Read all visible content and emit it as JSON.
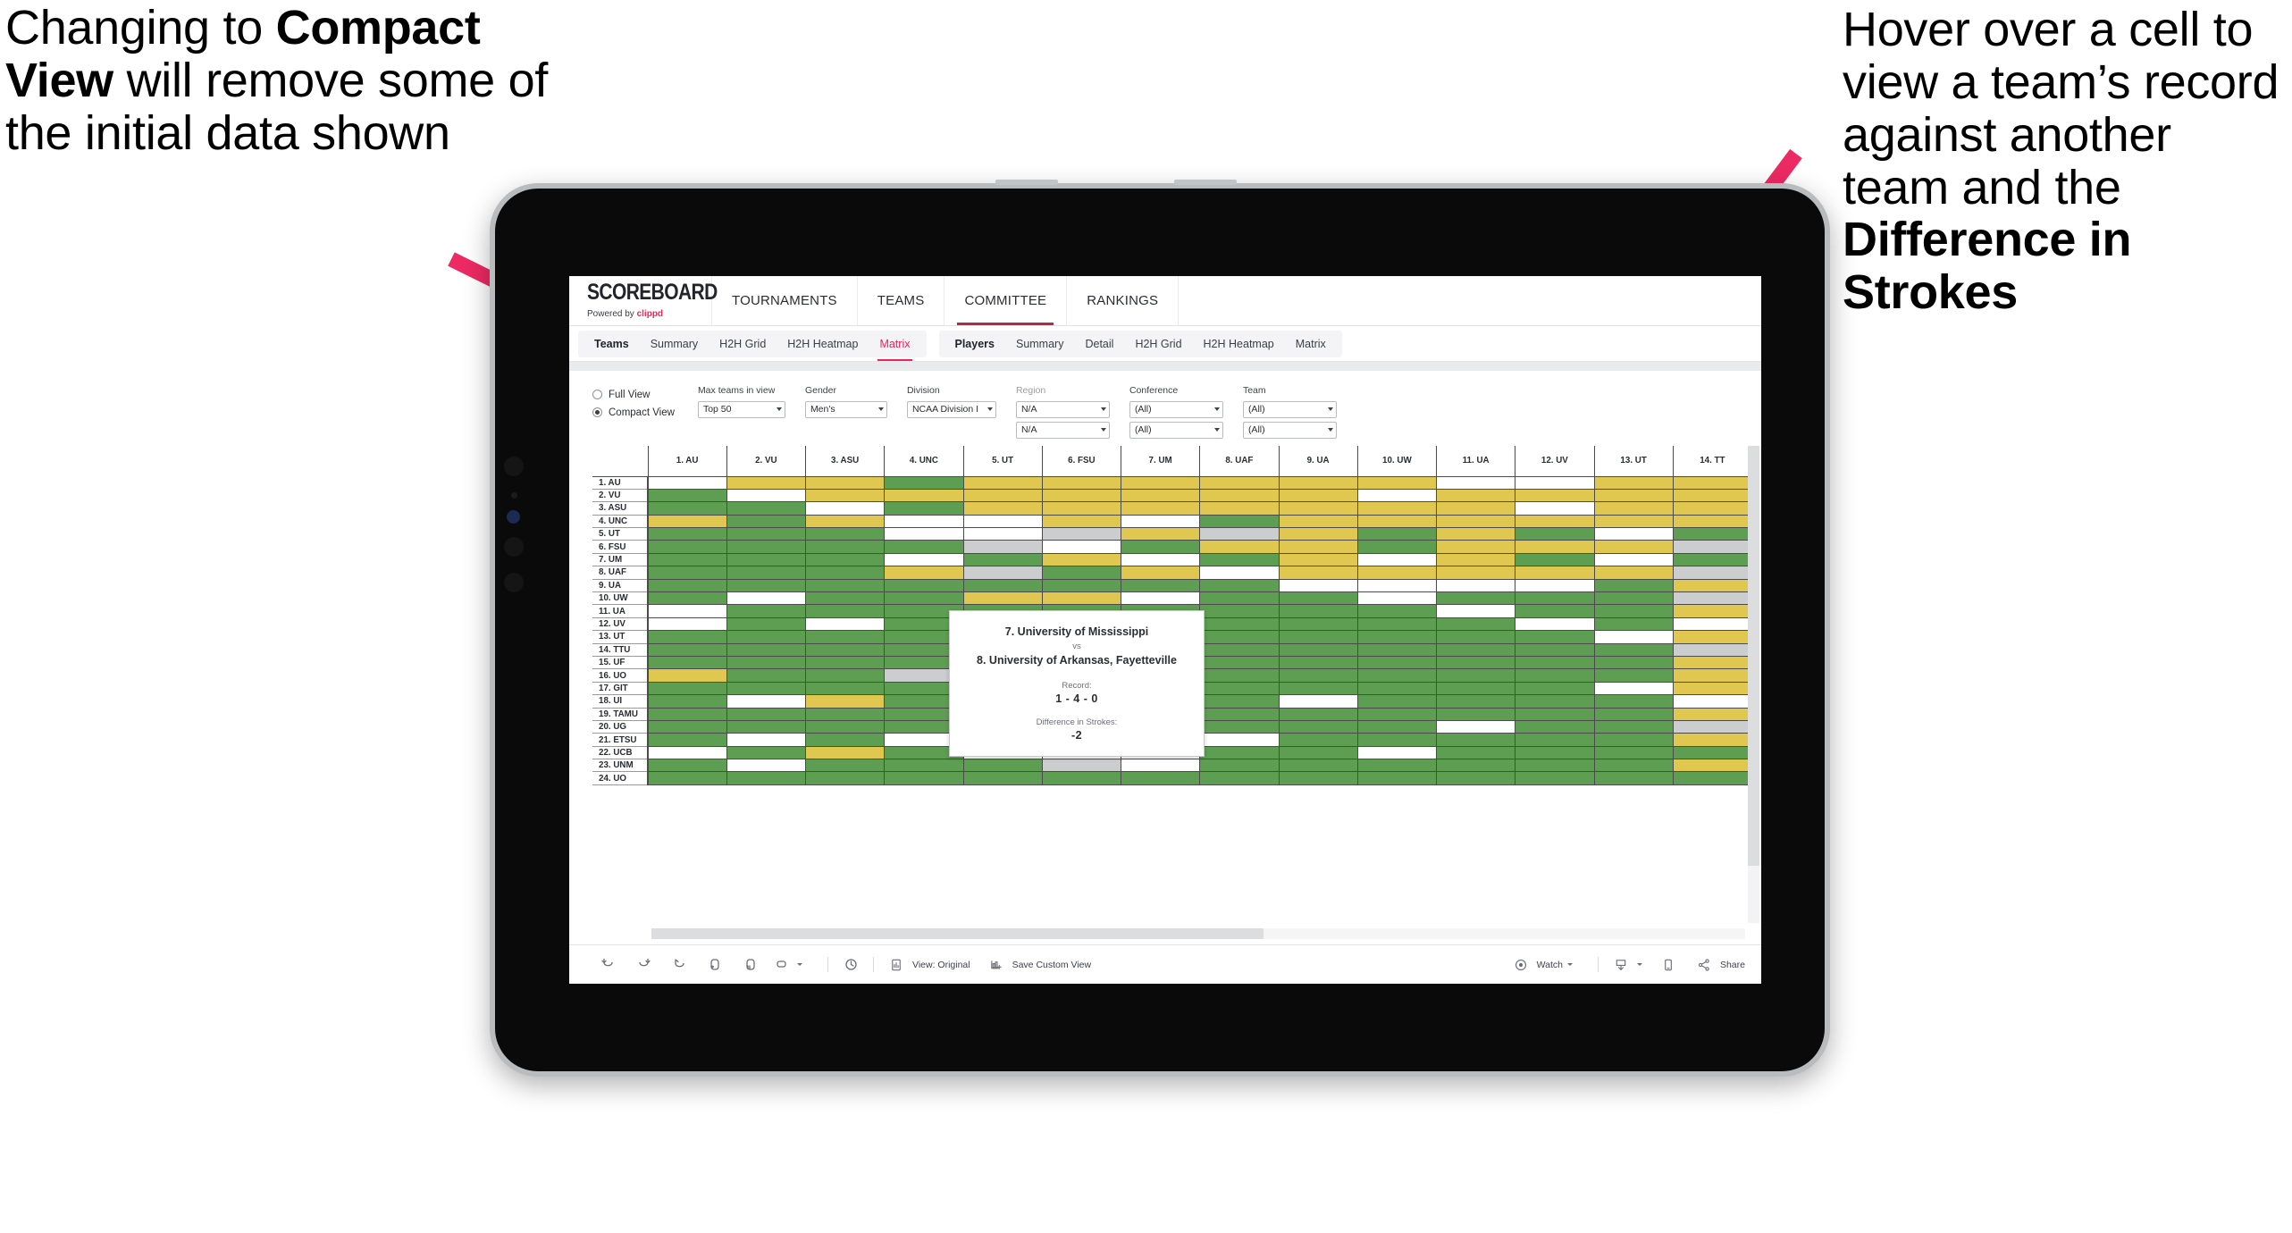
{
  "annotations": {
    "left": {
      "pre": "Changing to ",
      "bold": "Compact View",
      "post": " will remove some of the initial data shown"
    },
    "right": {
      "pre": "Hover over a cell to view a team’s record against another team and the ",
      "bold": "Difference in Strokes",
      "post": ""
    },
    "arrow_color": "#ed2a63"
  },
  "app": {
    "brand": {
      "logo": "SCOREBOARD",
      "powered_prefix": "Powered by ",
      "powered_name": "clippd"
    },
    "topnav": [
      {
        "label": "TOURNAMENTS",
        "active": false
      },
      {
        "label": "TEAMS",
        "active": false
      },
      {
        "label": "COMMITTEE",
        "active": true
      },
      {
        "label": "RANKINGS",
        "active": false
      }
    ],
    "subnav_teams": {
      "head": "Teams",
      "items": [
        "Summary",
        "H2H Grid",
        "H2H Heatmap",
        "Matrix"
      ],
      "active": "Matrix"
    },
    "subnav_players": {
      "head": "Players",
      "items": [
        "Summary",
        "Detail",
        "H2H Grid",
        "H2H Heatmap",
        "Matrix"
      ],
      "active": ""
    }
  },
  "filters": {
    "view_mode": {
      "options": [
        "Full View",
        "Compact View"
      ],
      "selected": "Compact View"
    },
    "fields": [
      {
        "label": "Max teams in view",
        "muted": false,
        "values": [
          "Top 50"
        ]
      },
      {
        "label": "Gender",
        "muted": false,
        "values": [
          "Men's"
        ]
      },
      {
        "label": "Division",
        "muted": false,
        "values": [
          "NCAA Division I"
        ]
      },
      {
        "label": "Region",
        "muted": true,
        "values": [
          "N/A",
          "N/A"
        ]
      },
      {
        "label": "Conference",
        "muted": false,
        "values": [
          "(All)",
          "(All)"
        ]
      },
      {
        "label": "Team",
        "muted": false,
        "values": [
          "(All)",
          "(All)"
        ]
      }
    ]
  },
  "tooltip": {
    "team_a": "7. University of Mississippi",
    "vs": "vs",
    "team_b": "8. University of Arkansas, Fayetteville",
    "record_label": "Record:",
    "record_value": "1 - 4 - 0",
    "diff_label": "Difference in Strokes:",
    "diff_value": "-2"
  },
  "toolbar": {
    "view_original": "View: Original",
    "save_custom_view": "Save Custom View",
    "watch": "Watch",
    "share": "Share"
  },
  "chart_data": {
    "type": "heatmap",
    "title": "Team Head-to-Head Matrix",
    "legend": {
      "win": "#5e9e52",
      "loss": "#e0c850",
      "tie": "#cccdcf",
      "none": "#ffffff"
    },
    "columns": [
      "1. AU",
      "2. VU",
      "3. ASU",
      "4. UNC",
      "5. UT",
      "6. FSU",
      "7. UM",
      "8. UAF",
      "9. UA",
      "10. UW",
      "11. UA",
      "12. UV",
      "13. UT",
      "14. TT"
    ],
    "rows": [
      "1. AU",
      "2. VU",
      "3. ASU",
      "4. UNC",
      "5. UT",
      "6. FSU",
      "7. UM",
      "8. UAF",
      "9. UA",
      "10. UW",
      "11. UA",
      "12. UV",
      "13. UT",
      "14. TTU",
      "15. UF",
      "16. UO",
      "17. GIT",
      "18. UI",
      "19. TAMU",
      "20. UG",
      "21. ETSU",
      "22. UCB",
      "23. UNM",
      "24. UO"
    ],
    "cells": [
      [
        "w",
        "y",
        "y",
        "g",
        "y",
        "y",
        "y",
        "y",
        "y",
        "y",
        "w",
        "w",
        "y",
        "y"
      ],
      [
        "g",
        "w",
        "y",
        "y",
        "y",
        "y",
        "y",
        "y",
        "y",
        "w",
        "y",
        "y",
        "y",
        "y"
      ],
      [
        "g",
        "g",
        "w",
        "g",
        "y",
        "y",
        "y",
        "y",
        "y",
        "y",
        "y",
        "w",
        "y",
        "y"
      ],
      [
        "y",
        "g",
        "y",
        "w",
        "w",
        "y",
        "w",
        "g",
        "y",
        "y",
        "y",
        "y",
        "y",
        "y"
      ],
      [
        "g",
        "g",
        "g",
        "w",
        "w",
        "s",
        "y",
        "s",
        "y",
        "g",
        "y",
        "g",
        "w",
        "g"
      ],
      [
        "g",
        "g",
        "g",
        "g",
        "s",
        "w",
        "g",
        "y",
        "y",
        "g",
        "y",
        "y",
        "y",
        "s"
      ],
      [
        "g",
        "g",
        "g",
        "w",
        "g",
        "y",
        "w",
        "g",
        "y",
        "w",
        "y",
        "g",
        "w",
        "g"
      ],
      [
        "g",
        "g",
        "g",
        "y",
        "s",
        "g",
        "y",
        "w",
        "y",
        "y",
        "y",
        "y",
        "y",
        "s"
      ],
      [
        "g",
        "g",
        "g",
        "g",
        "g",
        "g",
        "g",
        "g",
        "w",
        "w",
        "w",
        "w",
        "g",
        "y"
      ],
      [
        "g",
        "w",
        "g",
        "g",
        "y",
        "y",
        "w",
        "g",
        "g",
        "w",
        "g",
        "g",
        "g",
        "s"
      ],
      [
        "w",
        "g",
        "g",
        "g",
        "g",
        "g",
        "g",
        "g",
        "g",
        "g",
        "w",
        "g",
        "g",
        "y"
      ],
      [
        "w",
        "g",
        "w",
        "g",
        "y",
        "g",
        "y",
        "g",
        "g",
        "g",
        "g",
        "w",
        "g",
        "w"
      ],
      [
        "g",
        "g",
        "g",
        "g",
        "w",
        "g",
        "w",
        "g",
        "g",
        "g",
        "g",
        "g",
        "w",
        "y"
      ],
      [
        "g",
        "g",
        "g",
        "g",
        "y",
        "s",
        "y",
        "g",
        "g",
        "g",
        "g",
        "g",
        "g",
        "s"
      ],
      [
        "g",
        "g",
        "g",
        "g",
        "g",
        "g",
        "s",
        "g",
        "g",
        "g",
        "g",
        "g",
        "g",
        "y"
      ],
      [
        "y",
        "g",
        "g",
        "s",
        "g",
        "s",
        "y",
        "g",
        "g",
        "g",
        "g",
        "g",
        "g",
        "y"
      ],
      [
        "g",
        "g",
        "g",
        "g",
        "s",
        "g",
        "w",
        "g",
        "g",
        "g",
        "g",
        "g",
        "w",
        "y"
      ],
      [
        "g",
        "w",
        "y",
        "g",
        "w",
        "g",
        "w",
        "g",
        "w",
        "g",
        "g",
        "g",
        "g",
        "w"
      ],
      [
        "g",
        "g",
        "g",
        "g",
        "y",
        "g",
        "s",
        "g",
        "g",
        "g",
        "g",
        "g",
        "g",
        "y"
      ],
      [
        "g",
        "g",
        "g",
        "g",
        "g",
        "g",
        "w",
        "g",
        "g",
        "g",
        "w",
        "g",
        "g",
        "s"
      ],
      [
        "g",
        "w",
        "g",
        "w",
        "g",
        "g",
        "g",
        "w",
        "g",
        "g",
        "g",
        "g",
        "g",
        "y"
      ],
      [
        "w",
        "g",
        "y",
        "g",
        "w",
        "w",
        "w",
        "g",
        "g",
        "w",
        "g",
        "g",
        "g",
        "g"
      ],
      [
        "g",
        "w",
        "g",
        "g",
        "g",
        "s",
        "w",
        "g",
        "g",
        "g",
        "g",
        "g",
        "g",
        "y"
      ],
      [
        "g",
        "g",
        "g",
        "g",
        "g",
        "g",
        "g",
        "g",
        "g",
        "g",
        "g",
        "g",
        "g",
        "g"
      ]
    ]
  }
}
